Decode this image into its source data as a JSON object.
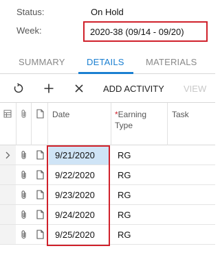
{
  "header": {
    "status_label": "Status:",
    "status_value": "On Hold",
    "week_label": "Week:",
    "week_value": "2020-38 (09/14 - 09/20)"
  },
  "tabs": [
    {
      "label": "SUMMARY",
      "active": false
    },
    {
      "label": "DETAILS",
      "active": true
    },
    {
      "label": "MATERIALS",
      "active": false
    }
  ],
  "toolbar": {
    "refresh_icon": "refresh-icon",
    "add_icon": "plus-icon",
    "delete_icon": "close-icon",
    "add_activity_label": "ADD ACTIVITY",
    "view_label": "VIEW"
  },
  "grid": {
    "columns": {
      "date": "Date",
      "earning_type_required": "*",
      "earning_type": "Earning Type",
      "task": "Task"
    },
    "rows": [
      {
        "date": "9/21/2020",
        "earning_type": "RG",
        "task": "",
        "selected": true
      },
      {
        "date": "9/22/2020",
        "earning_type": "RG",
        "task": "",
        "selected": false
      },
      {
        "date": "9/23/2020",
        "earning_type": "RG",
        "task": "",
        "selected": false
      },
      {
        "date": "9/24/2020",
        "earning_type": "RG",
        "task": "",
        "selected": false
      },
      {
        "date": "9/25/2020",
        "earning_type": "RG",
        "task": "",
        "selected": false
      }
    ]
  },
  "colors": {
    "accent": "#1a7fd1",
    "highlight_border": "#d0202a",
    "selected_row": "#cfe4f6"
  }
}
